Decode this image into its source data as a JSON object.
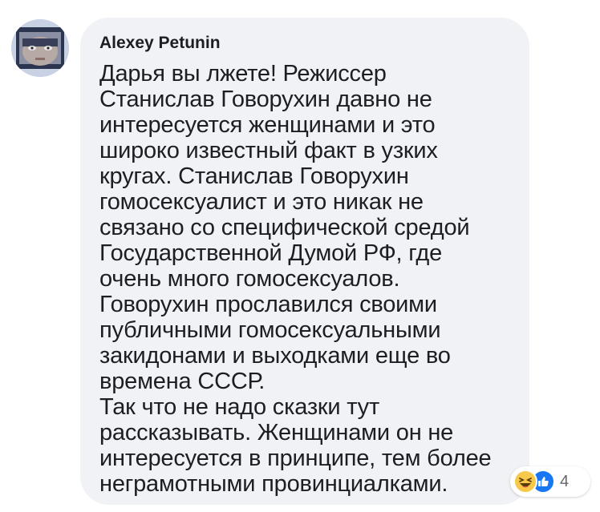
{
  "comment": {
    "author": "Alexey Petunin",
    "text_lines": [
      "Дарья вы лжете! Режиссер",
      "Станислав Говорухин давно не",
      "интересуется женщинами и это",
      "широко известный факт в узких",
      "кругах. Станислав Говорухин",
      "гомосексуалист и это никак не",
      "связано со специфической средой",
      "Государственной Думой РФ, где",
      "очень много гомосексуалов.",
      "Говорухин прославился своими",
      "публичными гомосексуальными",
      "закидонами и выходками еще во",
      "времена СССР.",
      "Так что не надо сказки тут",
      "рассказывать. Женщинами он не",
      "интересуется в принципе, тем более",
      "неграмотными провинциалками."
    ]
  },
  "reactions": {
    "icons": [
      "haha-icon",
      "like-icon"
    ],
    "count": "4"
  },
  "colors": {
    "bubble": "#f0f2f5",
    "text": "#1c1e21",
    "like": "#1877f2",
    "haha": "#f7c94b",
    "count": "#65676b"
  }
}
